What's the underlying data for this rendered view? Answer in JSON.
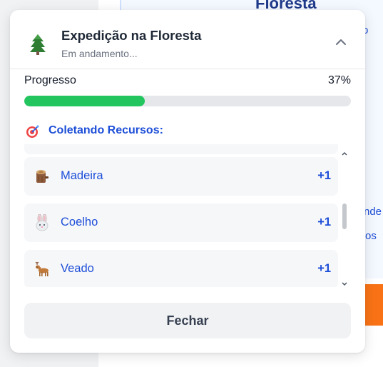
{
  "background": {
    "heading": "Floresta",
    "fragments": [
      "o",
      "nde",
      "os"
    ]
  },
  "popup": {
    "title": "Expedição na Floresta",
    "subtitle": "Em andamento...",
    "header_icon": "tree-icon",
    "progress": {
      "label": "Progresso",
      "value_text": "37%",
      "fraction": 0.37
    },
    "section": {
      "title": "Coletando Recursos:",
      "icon": "target-icon"
    },
    "items": [
      {
        "label": "Madeira",
        "count": "+1",
        "icon": "wood-log-icon"
      },
      {
        "label": "Coelho",
        "count": "+1",
        "icon": "rabbit-icon"
      },
      {
        "label": "Veado",
        "count": "+1",
        "icon": "deer-icon"
      }
    ],
    "close_label": "Fechar"
  },
  "colors": {
    "accent": "#1d4ed8",
    "progress": "#22c55e",
    "background_button": "#f97316"
  }
}
